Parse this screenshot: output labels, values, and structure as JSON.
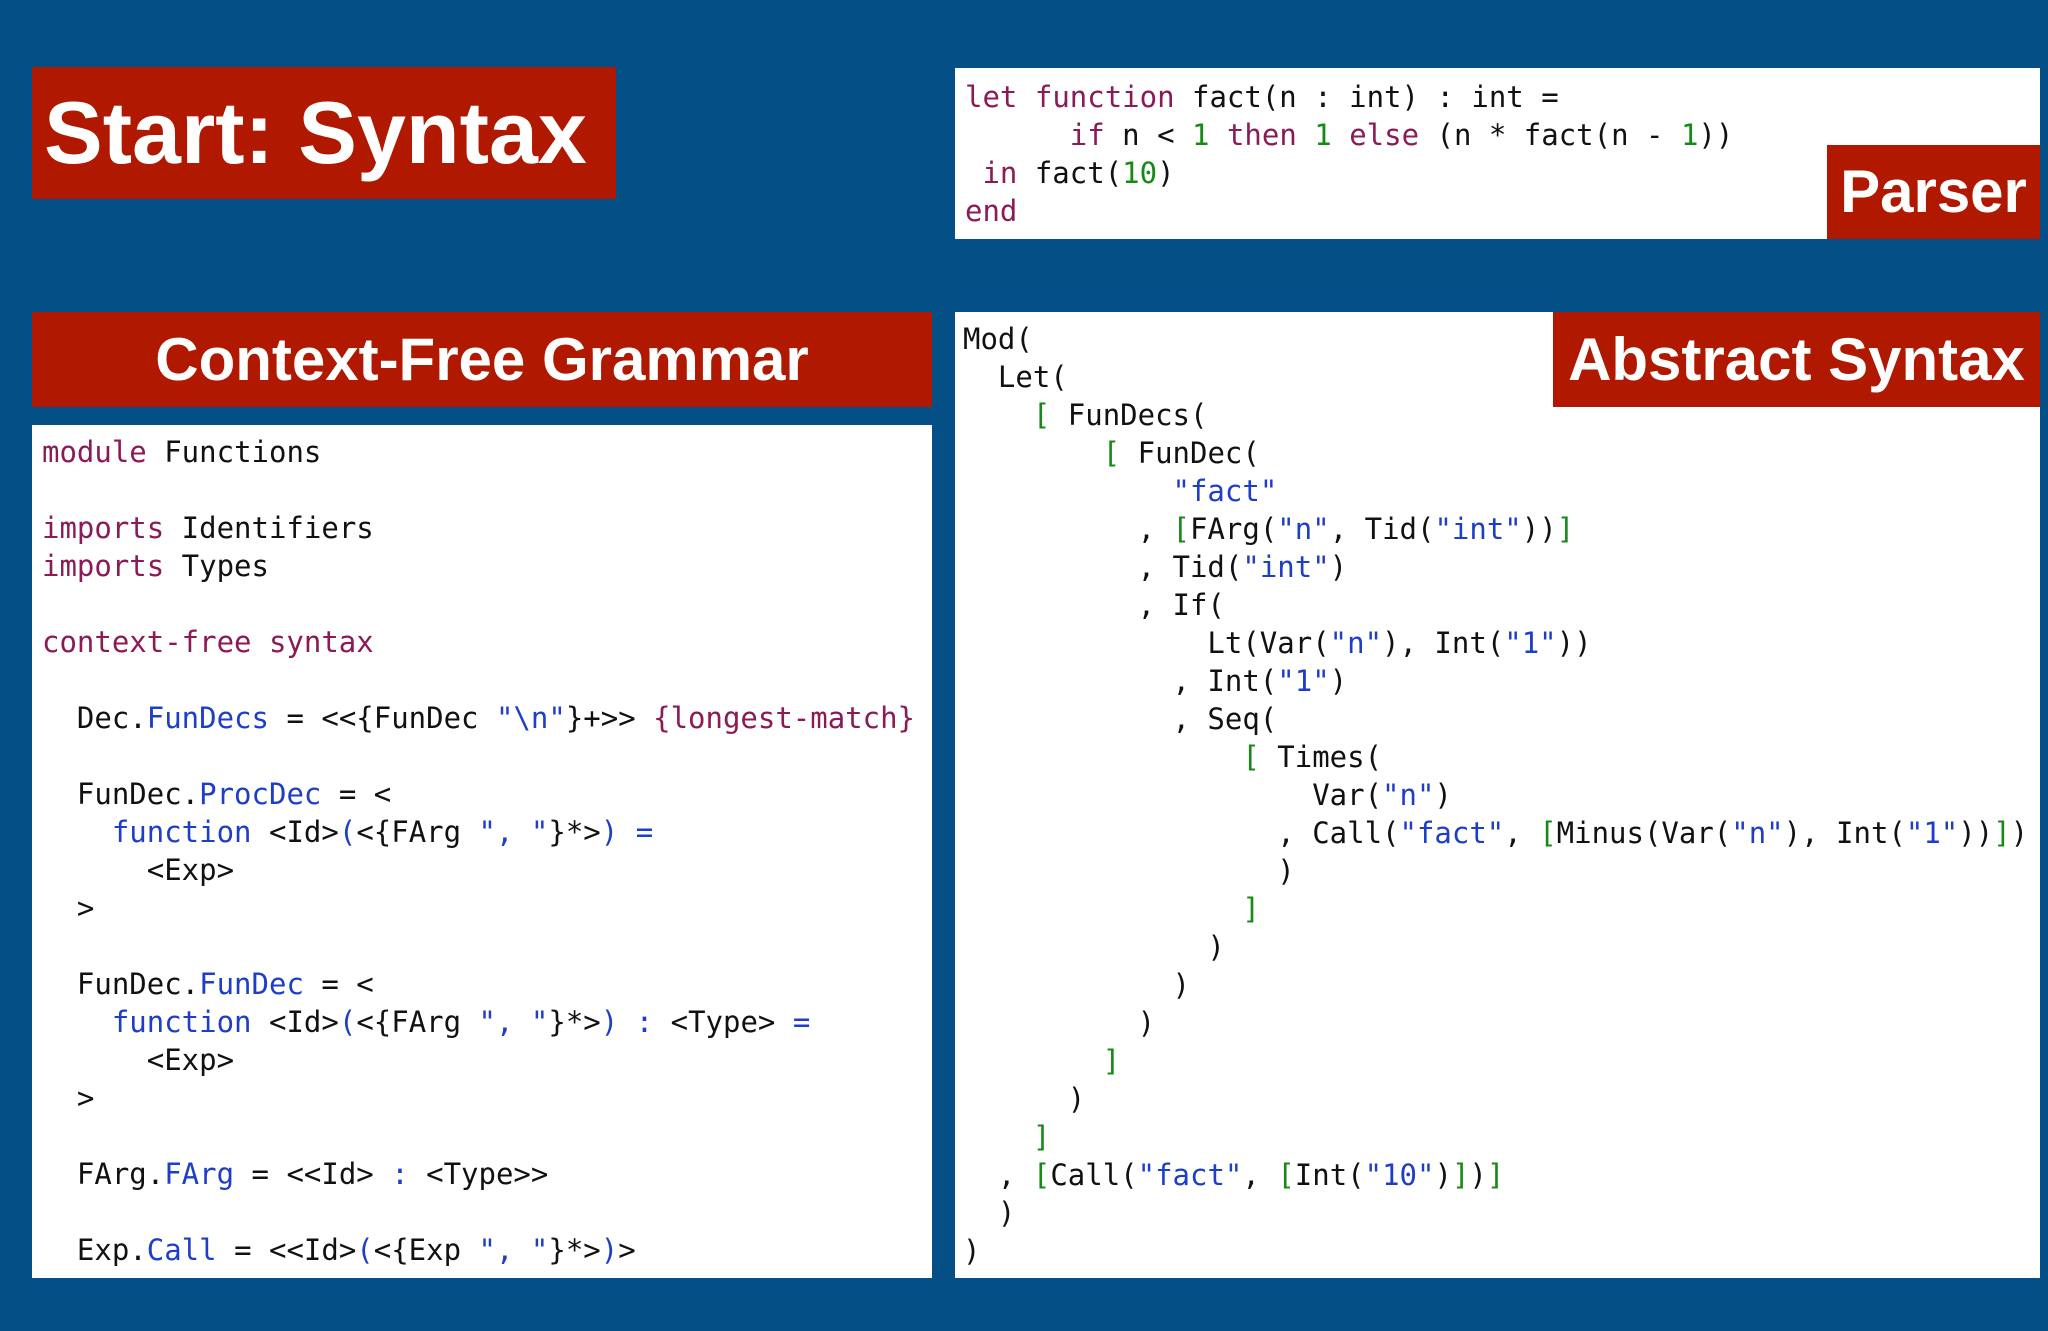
{
  "titles": {
    "main": "Start: Syntax",
    "cfg": "Context-Free Grammar",
    "ast": "Abstract Syntax",
    "parser": "Parser"
  },
  "source_code": [
    [
      [
        "k",
        "let"
      ],
      [
        "t",
        " "
      ],
      [
        "k",
        "function"
      ],
      [
        "t",
        " fact(n : int) : int ="
      ]
    ],
    [
      [
        "t",
        "      "
      ],
      [
        "k",
        "if"
      ],
      [
        "t",
        " n < "
      ],
      [
        "g",
        "1"
      ],
      [
        "t",
        " "
      ],
      [
        "k",
        "then"
      ],
      [
        "t",
        " "
      ],
      [
        "g",
        "1"
      ],
      [
        "t",
        " "
      ],
      [
        "k",
        "else"
      ],
      [
        "t",
        " (n * fact(n - "
      ],
      [
        "g",
        "1"
      ],
      [
        "t",
        "))"
      ]
    ],
    [
      [
        "t",
        " "
      ],
      [
        "k",
        "in"
      ],
      [
        "t",
        " fact("
      ],
      [
        "g",
        "10"
      ],
      [
        "t",
        ")"
      ]
    ],
    [
      [
        "k",
        "end"
      ]
    ]
  ],
  "grammar_code": [
    [
      [
        "k",
        "module"
      ],
      [
        "t",
        " Functions"
      ]
    ],
    [
      [
        "t",
        ""
      ]
    ],
    [
      [
        "k",
        "imports"
      ],
      [
        "t",
        " Identifiers"
      ]
    ],
    [
      [
        "k",
        "imports"
      ],
      [
        "t",
        " Types"
      ]
    ],
    [
      [
        "t",
        ""
      ]
    ],
    [
      [
        "k",
        "context-free syntax"
      ]
    ],
    [
      [
        "t",
        ""
      ]
    ],
    [
      [
        "t",
        "  Dec."
      ],
      [
        "b",
        "FunDecs"
      ],
      [
        "t",
        " = <<{FunDec "
      ],
      [
        "b",
        "\"\\n\""
      ],
      [
        "t",
        "}+>> "
      ],
      [
        "k",
        "{longest-match}"
      ]
    ],
    [
      [
        "t",
        ""
      ]
    ],
    [
      [
        "t",
        "  FunDec."
      ],
      [
        "b",
        "ProcDec"
      ],
      [
        "t",
        " = <"
      ]
    ],
    [
      [
        "t",
        "    "
      ],
      [
        "b",
        "function"
      ],
      [
        "t",
        " <Id>"
      ],
      [
        "b",
        "("
      ],
      [
        "t",
        "<{FArg "
      ],
      [
        "b",
        "\", \""
      ],
      [
        "t",
        "}*>"
      ],
      [
        "b",
        ")"
      ],
      [
        "t",
        " "
      ],
      [
        "b",
        "="
      ]
    ],
    [
      [
        "t",
        "      <Exp>"
      ]
    ],
    [
      [
        "t",
        "  >"
      ]
    ],
    [
      [
        "t",
        ""
      ]
    ],
    [
      [
        "t",
        "  FunDec."
      ],
      [
        "b",
        "FunDec"
      ],
      [
        "t",
        " = <"
      ]
    ],
    [
      [
        "t",
        "    "
      ],
      [
        "b",
        "function"
      ],
      [
        "t",
        " <Id>"
      ],
      [
        "b",
        "("
      ],
      [
        "t",
        "<{FArg "
      ],
      [
        "b",
        "\", \""
      ],
      [
        "t",
        "}*>"
      ],
      [
        "b",
        ")"
      ],
      [
        "t",
        " "
      ],
      [
        "b",
        ":"
      ],
      [
        "t",
        " <Type> "
      ],
      [
        "b",
        "="
      ]
    ],
    [
      [
        "t",
        "      <Exp>"
      ]
    ],
    [
      [
        "t",
        "  >"
      ]
    ],
    [
      [
        "t",
        ""
      ]
    ],
    [
      [
        "t",
        "  FArg."
      ],
      [
        "b",
        "FArg"
      ],
      [
        "t",
        " = <<Id> "
      ],
      [
        "b",
        ":"
      ],
      [
        "t",
        " <Type>>"
      ]
    ],
    [
      [
        "t",
        ""
      ]
    ],
    [
      [
        "t",
        "  Exp."
      ],
      [
        "b",
        "Call"
      ],
      [
        "t",
        " = <<Id>"
      ],
      [
        "b",
        "("
      ],
      [
        "t",
        "<{Exp "
      ],
      [
        "b",
        "\", \""
      ],
      [
        "t",
        "}*>"
      ],
      [
        "b",
        ")"
      ],
      [
        "t",
        ">"
      ]
    ]
  ],
  "ast_code": [
    [
      [
        "t",
        "Mod("
      ]
    ],
    [
      [
        "t",
        "  Let("
      ]
    ],
    [
      [
        "t",
        "    "
      ],
      [
        "g",
        "["
      ],
      [
        "t",
        " FunDecs("
      ]
    ],
    [
      [
        "t",
        "        "
      ],
      [
        "g",
        "["
      ],
      [
        "t",
        " FunDec("
      ]
    ],
    [
      [
        "t",
        "            "
      ],
      [
        "b",
        "\"fact\""
      ]
    ],
    [
      [
        "t",
        "          , "
      ],
      [
        "g",
        "["
      ],
      [
        "t",
        "FArg("
      ],
      [
        "b",
        "\"n\""
      ],
      [
        "t",
        ", Tid("
      ],
      [
        "b",
        "\"int\""
      ],
      [
        "t",
        "))"
      ],
      [
        "g",
        "]"
      ]
    ],
    [
      [
        "t",
        "          , Tid("
      ],
      [
        "b",
        "\"int\""
      ],
      [
        "t",
        ")"
      ]
    ],
    [
      [
        "t",
        "          , If("
      ]
    ],
    [
      [
        "t",
        "              Lt(Var("
      ],
      [
        "b",
        "\"n\""
      ],
      [
        "t",
        "), Int("
      ],
      [
        "b",
        "\"1\""
      ],
      [
        "t",
        "))"
      ]
    ],
    [
      [
        "t",
        "            , Int("
      ],
      [
        "b",
        "\"1\""
      ],
      [
        "t",
        ")"
      ]
    ],
    [
      [
        "t",
        "            , Seq("
      ]
    ],
    [
      [
        "t",
        "                "
      ],
      [
        "g",
        "["
      ],
      [
        "t",
        " Times("
      ]
    ],
    [
      [
        "t",
        "                    Var("
      ],
      [
        "b",
        "\"n\""
      ],
      [
        "t",
        ")"
      ]
    ],
    [
      [
        "t",
        "                  , Call("
      ],
      [
        "b",
        "\"fact\""
      ],
      [
        "t",
        ", "
      ],
      [
        "g",
        "["
      ],
      [
        "t",
        "Minus(Var("
      ],
      [
        "b",
        "\"n\""
      ],
      [
        "t",
        "), Int("
      ],
      [
        "b",
        "\"1\""
      ],
      [
        "t",
        "))"
      ],
      [
        "g",
        "]"
      ],
      [
        "t",
        ")"
      ]
    ],
    [
      [
        "t",
        "                  )"
      ]
    ],
    [
      [
        "t",
        "                "
      ],
      [
        "g",
        "]"
      ]
    ],
    [
      [
        "t",
        "              )"
      ]
    ],
    [
      [
        "t",
        "            )"
      ]
    ],
    [
      [
        "t",
        "          )"
      ]
    ],
    [
      [
        "t",
        "        "
      ],
      [
        "g",
        "]"
      ]
    ],
    [
      [
        "t",
        "      )"
      ]
    ],
    [
      [
        "t",
        "    "
      ],
      [
        "g",
        "]"
      ]
    ],
    [
      [
        "t",
        "  , "
      ],
      [
        "g",
        "["
      ],
      [
        "t",
        "Call("
      ],
      [
        "b",
        "\"fact\""
      ],
      [
        "t",
        ", "
      ],
      [
        "g",
        "["
      ],
      [
        "t",
        "Int("
      ],
      [
        "b",
        "\"10\""
      ],
      [
        "t",
        ")"
      ],
      [
        "g",
        "]"
      ],
      [
        "t",
        ")"
      ],
      [
        "g",
        "]"
      ]
    ],
    [
      [
        "t",
        "  )"
      ]
    ],
    [
      [
        "t",
        ")"
      ]
    ]
  ],
  "colors": {
    "background": "#044f85",
    "title_bar": "#b01800",
    "keyword": "#8b1a57",
    "identifier_blue": "#1e3ec8",
    "number_green": "#168a16"
  }
}
